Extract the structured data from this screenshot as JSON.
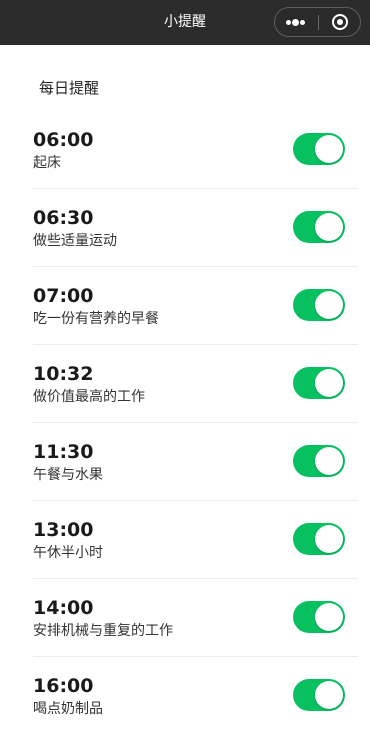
{
  "nav": {
    "title": "小提醒"
  },
  "section": {
    "title": "每日提醒"
  },
  "colors": {
    "nav_bg": "#2c2c2c",
    "toggle_on": "#07c160"
  },
  "reminders": [
    {
      "time": "06:00",
      "label": "起床",
      "enabled": true
    },
    {
      "time": "06:30",
      "label": "做些适量运动",
      "enabled": true
    },
    {
      "time": "07:00",
      "label": "吃一份有营养的早餐",
      "enabled": true
    },
    {
      "time": "10:32",
      "label": "做价值最高的工作",
      "enabled": true
    },
    {
      "time": "11:30",
      "label": "午餐与水果",
      "enabled": true
    },
    {
      "time": "13:00",
      "label": "午休半小时",
      "enabled": true
    },
    {
      "time": "14:00",
      "label": "安排机械与重复的工作",
      "enabled": true
    },
    {
      "time": "16:00",
      "label": "喝点奶制品",
      "enabled": true
    }
  ]
}
